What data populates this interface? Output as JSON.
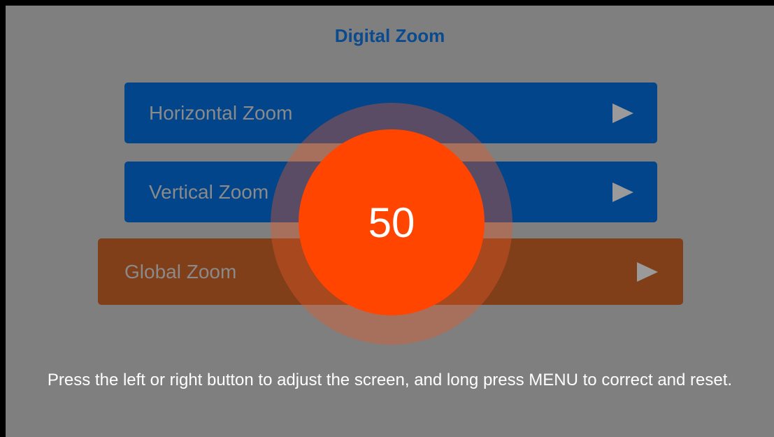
{
  "title": "Digital Zoom",
  "menu": {
    "items": [
      {
        "label": "Horizontal Zoom",
        "icon": "play-arrow-icon"
      },
      {
        "label": "Vertical Zoom",
        "icon": "play-arrow-icon"
      },
      {
        "label": "Global Zoom",
        "icon": "play-arrow-icon",
        "selected": true
      }
    ]
  },
  "dial": {
    "value": "50"
  },
  "hint": "Press the left or right button to adjust the screen, and long press MENU to correct and reset.",
  "colors": {
    "background": "#7f7f7f",
    "title": "#0a4a8f",
    "item": "#02458a",
    "selected_item": "#803e19",
    "dial": "#ff4500"
  }
}
